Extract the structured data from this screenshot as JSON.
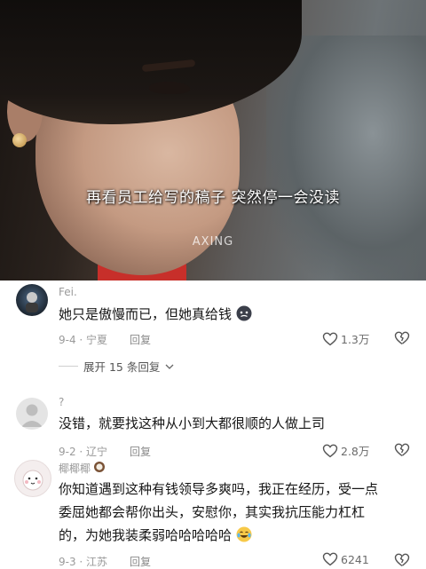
{
  "video": {
    "subtitle": "再看员工给写的稿子 突然停一会没读",
    "watermark": "AXING"
  },
  "comments": [
    {
      "username": "Fei.",
      "text": "她只是傲慢而已，但她真给钱",
      "emoji": "angry-face-emoji",
      "date_location": "9-4 · 宁夏",
      "reply_label": "回复",
      "likes": "1.3万",
      "expand_label": "展开 15 条回复"
    },
    {
      "username": "?",
      "text": "没错，就要找这种从小到大都很顺的人做上司",
      "date_location": "9-2 · 辽宁",
      "reply_label": "回复",
      "likes": "2.8万"
    },
    {
      "username": "椰椰椰",
      "text_lines": [
        "你知道遇到这种有钱领导多爽吗，我正在经历，受一点",
        "委屈她都会帮你出头，安慰你，其实我抗压能力杠杠",
        "的，为她我装柔弱哈哈哈哈哈"
      ],
      "emoji": "laughing-tears-emoji",
      "date_location": "9-3 · 江苏",
      "reply_label": "回复",
      "likes": "6241"
    }
  ],
  "colors": {
    "text": "#161616",
    "meta": "#9a9a9a",
    "collar_red": "#c72f2a"
  }
}
